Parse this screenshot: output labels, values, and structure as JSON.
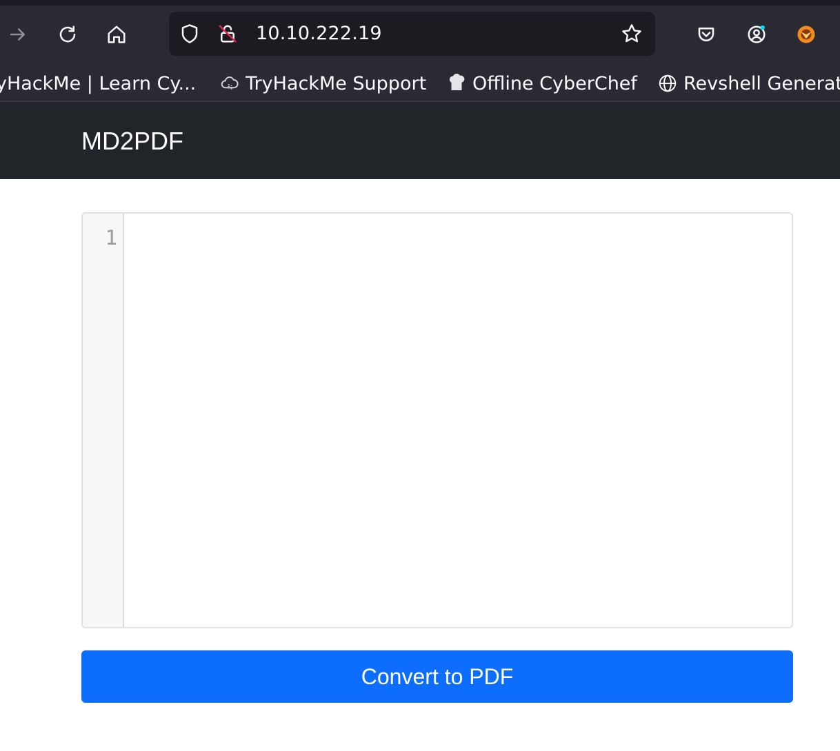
{
  "browser": {
    "url": "10.10.222.19",
    "bookmarks": [
      {
        "label": "yHackMe | Learn Cy...",
        "icon": "thm-icon"
      },
      {
        "label": "TryHackMe Support",
        "icon": "cloud-icon"
      },
      {
        "label": "Offline CyberChef",
        "icon": "chef-hat-icon"
      },
      {
        "label": "Revshell Generat",
        "icon": "globe-icon"
      }
    ]
  },
  "app": {
    "brand": "MD2PDF",
    "editor": {
      "line_numbers": [
        "1"
      ],
      "content": ""
    },
    "convert_label": "Convert to PDF"
  },
  "colors": {
    "browser_bg": "#2b2a33",
    "navbar_bg": "#212529",
    "button_bg": "#0d6efd"
  }
}
